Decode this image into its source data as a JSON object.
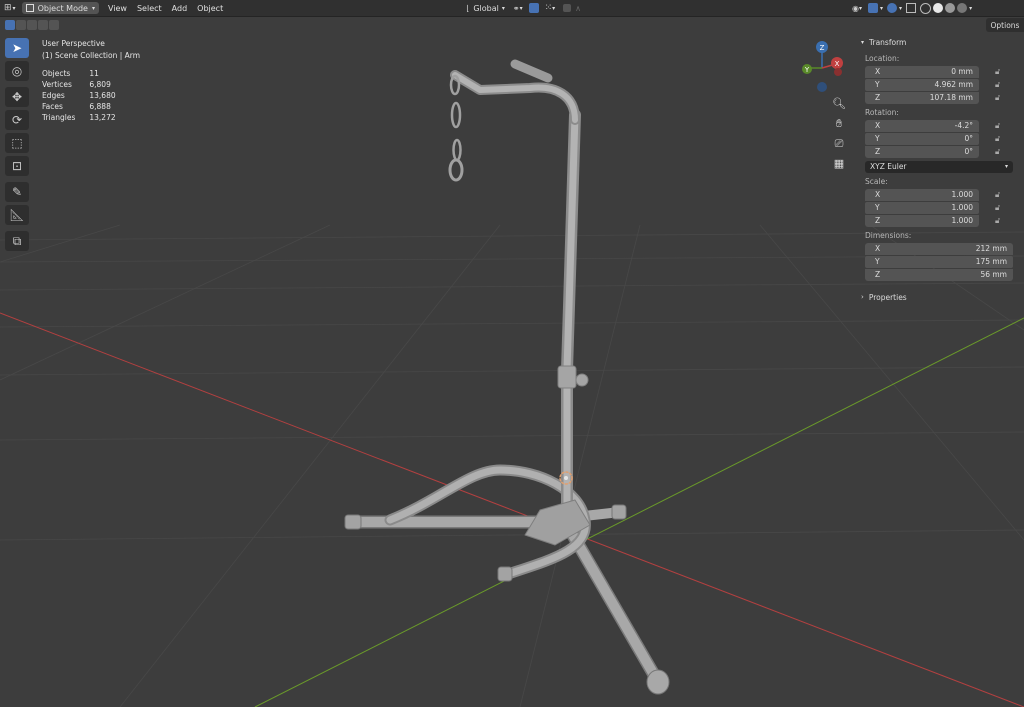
{
  "header": {
    "mode": "Object Mode",
    "menus": [
      "View",
      "Select",
      "Add",
      "Object"
    ],
    "orientation": "Global"
  },
  "options_label": "Options",
  "overlay": {
    "view_name": "User Perspective",
    "collection": "(1) Scene Collection | Arm",
    "stats": [
      {
        "label": "Objects",
        "value": "11"
      },
      {
        "label": "Vertices",
        "value": "6,809"
      },
      {
        "label": "Edges",
        "value": "13,680"
      },
      {
        "label": "Faces",
        "value": "6,888"
      },
      {
        "label": "Triangles",
        "value": "13,272"
      }
    ]
  },
  "gizmo": {
    "x": "X",
    "y": "Y",
    "z": "Z"
  },
  "npanel": {
    "transform_title": "Transform",
    "location_label": "Location:",
    "location": [
      {
        "axis": "X",
        "value": "0 mm"
      },
      {
        "axis": "Y",
        "value": "4.962 mm"
      },
      {
        "axis": "Z",
        "value": "107.18 mm"
      }
    ],
    "rotation_label": "Rotation:",
    "rotation": [
      {
        "axis": "X",
        "value": "-4.2°"
      },
      {
        "axis": "Y",
        "value": "0°"
      },
      {
        "axis": "Z",
        "value": "0°"
      }
    ],
    "rotation_mode": "XYZ Euler",
    "scale_label": "Scale:",
    "scale": [
      {
        "axis": "X",
        "value": "1.000"
      },
      {
        "axis": "Y",
        "value": "1.000"
      },
      {
        "axis": "Z",
        "value": "1.000"
      }
    ],
    "dimensions_label": "Dimensions:",
    "dimensions": [
      {
        "axis": "X",
        "value": "212 mm"
      },
      {
        "axis": "Y",
        "value": "175 mm"
      },
      {
        "axis": "Z",
        "value": "56 mm"
      }
    ],
    "properties_title": "Properties"
  },
  "colors": {
    "viewport_bg": "#3d3d3d",
    "header_bg": "#303030",
    "accent": "#4772b3",
    "axis_x": "#b34040",
    "axis_y": "#6a9a2a",
    "model": "#a8a8a8"
  }
}
